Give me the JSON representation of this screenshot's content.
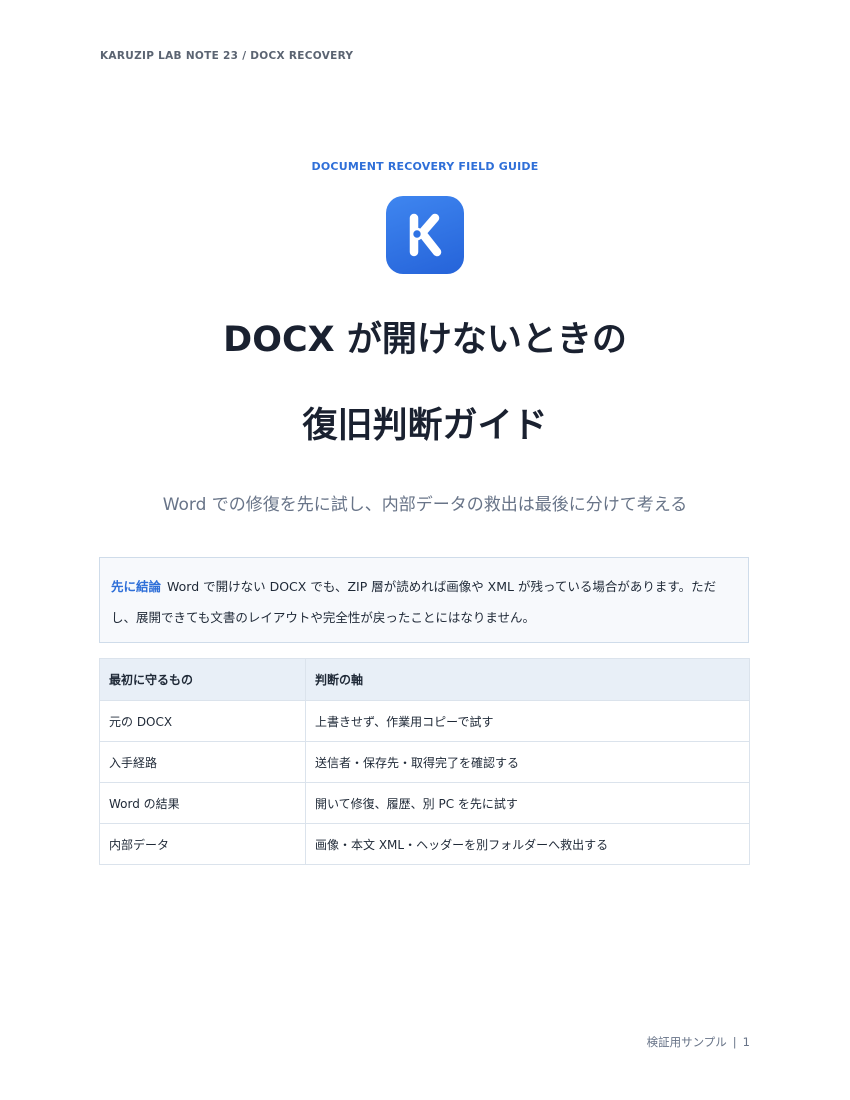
{
  "running_head": "KARUZIP LAB NOTE 23  /  DOCX RECOVERY",
  "eyebrow": "DOCUMENT RECOVERY FIELD GUIDE",
  "logo_icon": "karuzip-k-logo-icon",
  "colors": {
    "accent": "#2f6fd8",
    "logo": "#2f73e4",
    "callout_bg": "#f7f9fc",
    "table_header_bg": "#e8eff7"
  },
  "title": {
    "line1": "DOCX が開けないときの",
    "line2": "復旧判断ガイド"
  },
  "subtitle": "Word での修復を先に試し、内部データの救出は最後に分けて考える",
  "callout": {
    "lead": "先に結論",
    "text": "Word で開けない DOCX でも、ZIP 層が読めれば画像や XML が残っている場合があります。ただし、展開できても文書のレイアウトや完全性が戻ったことにはなりません。"
  },
  "table": {
    "headers": [
      "最初に守るもの",
      "判断の軸"
    ],
    "rows": [
      [
        "元の DOCX",
        "上書きせず、作業用コピーで試す"
      ],
      [
        "入手経路",
        "送信者・保存先・取得完了を確認する"
      ],
      [
        "Word の結果",
        "開いて修復、履歴、別 PC を先に試す"
      ],
      [
        "内部データ",
        "画像・本文 XML・ヘッダーを別フォルダーへ救出する"
      ]
    ]
  },
  "footer": {
    "label": "検証用サンプル",
    "separator": "|",
    "page": "1"
  }
}
